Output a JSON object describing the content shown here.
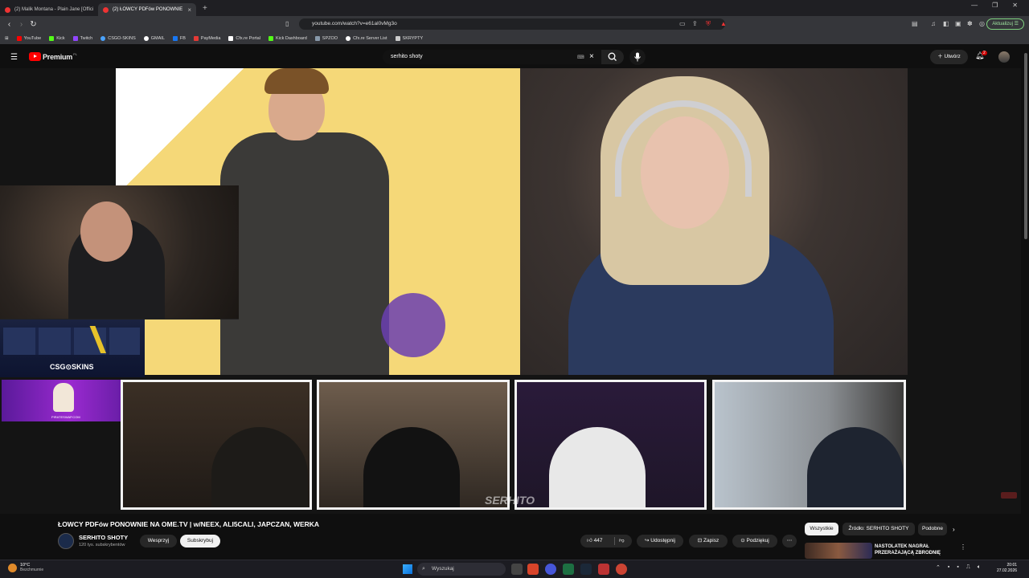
{
  "browser": {
    "tabs": [
      {
        "title": "(2) Malik Montana - Plain Jane [Offici"
      },
      {
        "title": "(2) ŁOWCY PDFów PONOWNIE"
      }
    ],
    "url": "youtube.com/watch?v=e61al0vMg3o",
    "update_label": "Aktualizuj",
    "bookmarks": [
      {
        "label": "YouTube",
        "color": "#ff0000"
      },
      {
        "label": "Kick",
        "color": "#53fc18"
      },
      {
        "label": "Twitch",
        "color": "#9146ff"
      },
      {
        "label": "CSGO-SKINS",
        "color": "#4aa3ff"
      },
      {
        "label": "GMAIL",
        "color": "#ffffff"
      },
      {
        "label": "FB",
        "color": "#1877f2"
      },
      {
        "label": "PayMedia",
        "color": "#e53935"
      },
      {
        "label": "Cfx.re Portal",
        "color": "#ffffff"
      },
      {
        "label": "Kick Dashboard",
        "color": "#53fc18"
      },
      {
        "label": "SPZOO",
        "color": "#8899aa"
      },
      {
        "label": "Cfx.re Server List",
        "color": "#ffffff"
      },
      {
        "label": "SKRYPTY",
        "color": "#cccccc"
      }
    ]
  },
  "youtube": {
    "logo_text": "Premium",
    "logo_region": "PL",
    "search_query": "serhito shoty",
    "create_label": "Utwórz",
    "notification_count": "2"
  },
  "video": {
    "ad_csgo_label": "CSG⊙SKINS",
    "ad_pirate_label": "PIRATESWAP.COM",
    "watermark": "SERHITO"
  },
  "meta": {
    "title": "ŁOWCY PDFów PONOWNIE NA OME.TV | w/NEEX, ALI5CALI, JAPCZAN, WERKA",
    "channel_name": "SERHITO SHOTY",
    "subscribers": "120 tys. subskrybentów",
    "support_label": "Wesprzyj",
    "subscribe_label": "Subskrybuj",
    "likes": "447",
    "share_label": "Udostępnij",
    "save_label": "Zapisz",
    "thanks_label": "Podziękuj"
  },
  "sidebar": {
    "chips": [
      "Wszystkie",
      "Źródło: SERHITO SHOTY",
      "Podobne"
    ],
    "rec_title": "NASTOLATEK NAGRAŁ PRZERAŻAJĄCĄ ZBRODNIĘ"
  },
  "taskbar": {
    "weather_temp": "10°C",
    "weather_desc": "Bezchmurnie",
    "search_label": "Wyszukaj",
    "time": "20:01",
    "date": "27.02.2026"
  }
}
